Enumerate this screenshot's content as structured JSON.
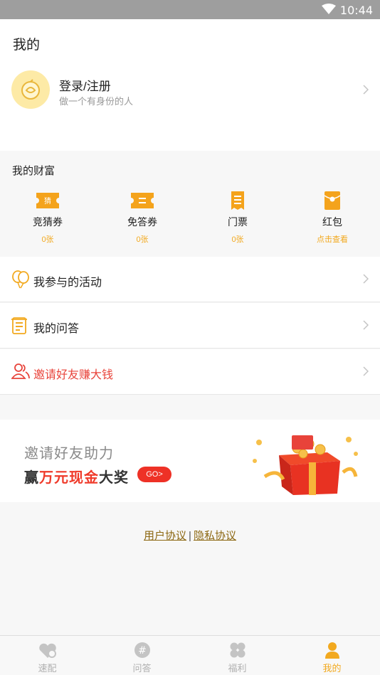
{
  "status_bar": {
    "time": "10:44"
  },
  "page": {
    "title": "我的"
  },
  "profile": {
    "login_label": "登录/注册",
    "subtitle": "做一个有身份的人"
  },
  "wealth": {
    "title": "我的财富",
    "items": [
      {
        "icon": "guess-ticket-icon",
        "icon_text": "猜",
        "label": "竞猜券",
        "value": "0张"
      },
      {
        "icon": "free-answer-ticket-icon",
        "label": "免答券",
        "value": "0张"
      },
      {
        "icon": "admission-ticket-icon",
        "label": "门票",
        "value": "0张"
      },
      {
        "icon": "red-packet-icon",
        "label": "红包",
        "value": "点击查看"
      }
    ]
  },
  "menu": [
    {
      "icon": "balloons-icon",
      "label": "我参与的活动"
    },
    {
      "icon": "qa-document-icon",
      "label": "我的问答"
    },
    {
      "icon": "invite-friends-icon",
      "label": "邀请好友赚大钱"
    }
  ],
  "banner": {
    "line1": "邀请好友助力",
    "line2_prefix": "赢",
    "line2_highlight": "万元现金",
    "line2_suffix": "大奖",
    "go_label": "GO>"
  },
  "links": {
    "user_agreement": "用户协议",
    "separator": "|",
    "privacy": "隐私协议"
  },
  "tabs": [
    {
      "icon": "heart-icon",
      "label": "速配"
    },
    {
      "icon": "hash-icon",
      "label": "问答"
    },
    {
      "icon": "clover-icon",
      "label": "福利"
    },
    {
      "icon": "person-icon",
      "label": "我的",
      "active": true
    }
  ],
  "colors": {
    "accent": "#f2a91f",
    "red": "#e8433a",
    "tab_inactive": "#b0b0b0"
  }
}
